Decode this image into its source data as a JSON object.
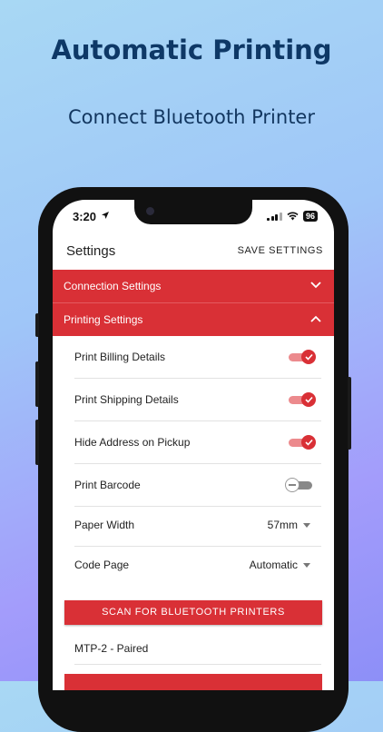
{
  "promo": {
    "headline": "Automatic Printing",
    "subline": "Connect Bluetooth Printer"
  },
  "status_bar": {
    "time": "3:20",
    "location_icon": "location-arrow-icon",
    "battery": "96"
  },
  "appbar": {
    "title": "Settings",
    "action": "SAVE SETTINGS"
  },
  "sections": {
    "connection": {
      "label": "Connection Settings",
      "icon": "chevron-down-icon"
    },
    "printing": {
      "label": "Printing Settings",
      "icon": "chevron-up-icon"
    }
  },
  "settings": {
    "print_billing": {
      "label": "Print Billing Details",
      "on": true
    },
    "print_shipping": {
      "label": "Print Shipping Details",
      "on": true
    },
    "hide_address": {
      "label": "Hide Address on Pickup",
      "on": true
    },
    "print_barcode": {
      "label": "Print Barcode",
      "on": false
    },
    "paper_width": {
      "label": "Paper Width",
      "value": "57mm"
    },
    "code_page": {
      "label": "Code Page",
      "value": "Automatic"
    }
  },
  "scan_button": "SCAN FOR BLUETOOTH PRINTERS",
  "device": "MTP-2 - Paired",
  "colors": {
    "accent": "#d93036",
    "headline": "#0e3866"
  }
}
